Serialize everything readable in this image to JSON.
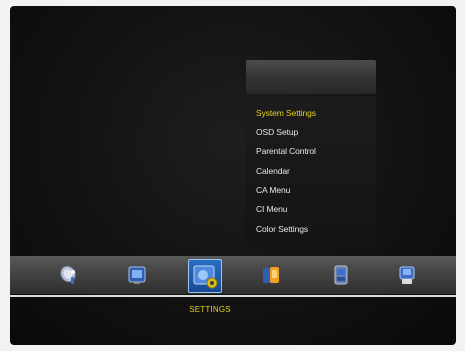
{
  "menu": {
    "items": [
      {
        "label": "System Settings",
        "selected": true
      },
      {
        "label": "OSD Setup",
        "selected": false
      },
      {
        "label": "Parental Control",
        "selected": false
      },
      {
        "label": "Calendar",
        "selected": false
      },
      {
        "label": "CA Menu",
        "selected": false
      },
      {
        "label": "CI Menu",
        "selected": false
      },
      {
        "label": "Color Settings",
        "selected": false
      }
    ]
  },
  "dock": {
    "selected_label": "SETTINGS",
    "icons": [
      "satellite-dish-icon",
      "tv-channel-icon",
      "settings-icon",
      "media-player-icon",
      "games-icon",
      "tools-icon"
    ]
  },
  "colors": {
    "highlight": "#e8d21a",
    "text": "#e8e8e8",
    "selection": "#2a6fc4"
  }
}
